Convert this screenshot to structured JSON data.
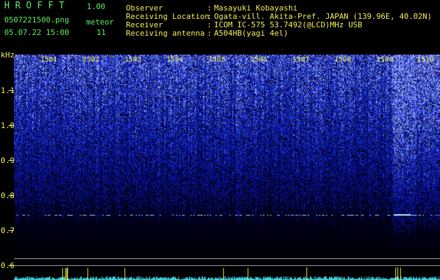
{
  "header": {
    "app_name": "H R O F F T",
    "version": "1.00",
    "filename": "0507221500.png",
    "meteor_label": "meteor",
    "datetime": "05.07.22 15:00",
    "meteor_count": "11"
  },
  "info": [
    {
      "label": "Observer",
      "sep": ":",
      "value": "Masayuki Kobayashi"
    },
    {
      "label": "Receiving Location",
      "sep": ":",
      "value": "Ogata-vill. Akita-Pref. JAPAN (139.96E, 40.02N)"
    },
    {
      "label": "Receiver",
      "sep": ":",
      "value": "ICOM IC-575 53.7492(@LCD)MHz USB"
    },
    {
      "label": "Receiving antenna",
      "sep": ":",
      "value": "A504HB(yagi 4el)"
    }
  ],
  "y_axis": {
    "unit": "kHz",
    "ticks": [
      "1.1",
      "1.0",
      "0.9",
      "0.8",
      "0.7",
      "0.6"
    ]
  },
  "time_axis": {
    "ticks": [
      "1501",
      "1502",
      "1503",
      "1504",
      "1505",
      "1506",
      "1507",
      "1508",
      "1509",
      "1510"
    ]
  },
  "colors": {
    "background": "#000000",
    "label_green": "#5ef05e",
    "label_yellow": "#f0f05a",
    "spectrum_blue": "#3c5cff",
    "echo_cyan": "#7fd8ff",
    "power_cyan": "#40d0e0"
  }
}
